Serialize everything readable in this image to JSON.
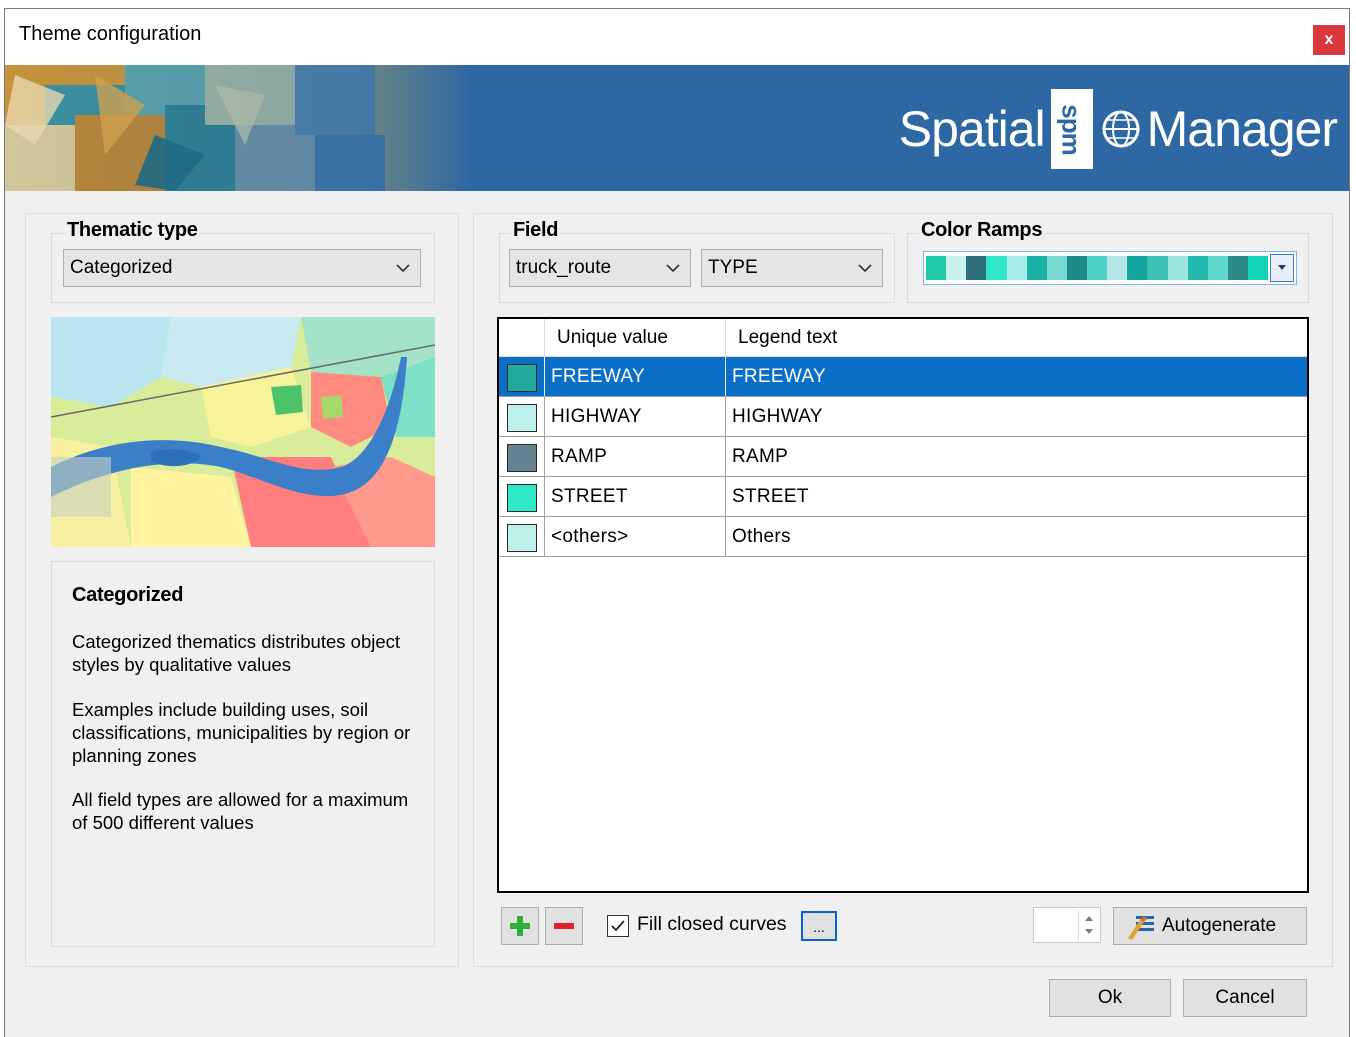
{
  "window": {
    "title": "Theme configuration",
    "close_label": "x"
  },
  "banner": {
    "brand_left": "Spatial",
    "brand_badge": "spm",
    "brand_right": "Manager"
  },
  "thematic": {
    "label": "Thematic type",
    "selected": "Categorized"
  },
  "description": {
    "title": "Categorized",
    "paragraphs": [
      "Categorized thematics distributes object styles by qualitative values",
      "Examples include building uses, soil classifications, municipalities by region or planning zones",
      "All field types are allowed for a maximum of 500 different values"
    ]
  },
  "field": {
    "label": "Field",
    "table_value": "truck_route",
    "column_value": "TYPE"
  },
  "color_ramps": {
    "label": "Color Ramps",
    "colors": [
      "#1ec9a8",
      "#c9f0ec",
      "#2e6f7d",
      "#2fe6c8",
      "#a8ecea",
      "#1ab0a6",
      "#7ad8d2",
      "#1d8a8a",
      "#4dd0c6",
      "#b3e8e4",
      "#16a6a0",
      "#3ec0b6",
      "#9ae6dc",
      "#21b9ad",
      "#5ed8cc",
      "#2a8a86",
      "#12d4b8"
    ]
  },
  "grid": {
    "headers": [
      "Unique value",
      "Legend text"
    ],
    "rows": [
      {
        "value": "FREEWAY",
        "legend": "FREEWAY",
        "color": "#21a99e",
        "selected": true
      },
      {
        "value": "HIGHWAY",
        "legend": "HIGHWAY",
        "color": "#bdf0ea",
        "selected": false
      },
      {
        "value": "RAMP",
        "legend": "RAMP",
        "color": "#62838f",
        "selected": false
      },
      {
        "value": "STREET",
        "legend": "STREET",
        "color": "#2ee8c8",
        "selected": false
      },
      {
        "value": "<others>",
        "legend": "Others",
        "color": "#bdf0ea",
        "selected": false
      }
    ]
  },
  "footer": {
    "fill_label": "Fill closed curves",
    "fill_checked": true,
    "ellipsis_label": "...",
    "autogenerate_label": "Autogenerate",
    "ok_label": "Ok",
    "cancel_label": "Cancel"
  }
}
